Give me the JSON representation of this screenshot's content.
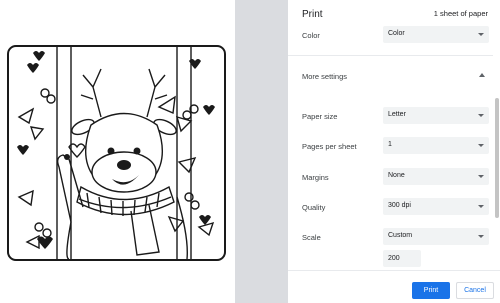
{
  "dialog": {
    "title": "Print",
    "sheet_count": "1 sheet of paper"
  },
  "settings": {
    "color": {
      "label": "Color",
      "value": "Color"
    },
    "more_settings": {
      "label": "More settings",
      "expanded": true
    },
    "paper_size": {
      "label": "Paper size",
      "value": "Letter"
    },
    "pages_per_sheet": {
      "label": "Pages per sheet",
      "value": "1"
    },
    "margins": {
      "label": "Margins",
      "value": "None"
    },
    "quality": {
      "label": "Quality",
      "value": "300 dpi"
    },
    "scale": {
      "label": "Scale",
      "value": "Custom",
      "custom_value": "200"
    }
  },
  "buttons": {
    "print": "Print",
    "cancel": "Cancel"
  },
  "colors": {
    "accent": "#1a73e8",
    "gutter": "#dadce0",
    "select_bg": "#f1f3f4"
  },
  "icons": [
    "chevron-up-icon",
    "dropdown-caret-icon"
  ]
}
